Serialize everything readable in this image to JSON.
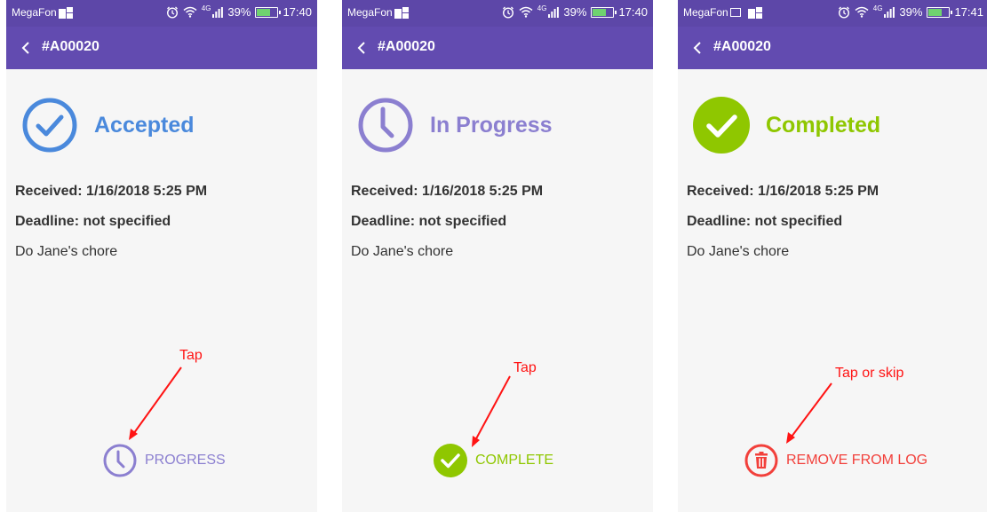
{
  "status_bar": {
    "screens": [
      {
        "carrier": "MegaFon",
        "network": "4G",
        "battery": "39%",
        "battery_level": 0.39,
        "time": "17:40"
      },
      {
        "carrier": "MegaFon",
        "network": "4G",
        "battery": "39%",
        "battery_level": 0.39,
        "time": "17:40"
      },
      {
        "carrier": "MegaFon",
        "network": "4G",
        "battery": "39%",
        "battery_level": 0.39,
        "time": "17:41"
      }
    ]
  },
  "app_bar": {
    "title": "#A00020"
  },
  "details": {
    "received": "Received: 1/16/2018 5:25 PM",
    "deadline": "Deadline: not specified",
    "description": "Do Jane's chore"
  },
  "screens": [
    {
      "status": "Accepted",
      "status_color": "#4a89dc",
      "status_icon": "check-circle-outline-icon",
      "action": "PROGRESS",
      "action_color": "#8b7fd0",
      "action_icon": "clock-icon",
      "annotation": "Tap"
    },
    {
      "status": "In Progress",
      "status_color": "#8b7fd0",
      "status_icon": "clock-icon",
      "action": "COMPLETE",
      "action_color": "#8fc700",
      "action_icon": "check-circle-filled-icon",
      "annotation": "Tap"
    },
    {
      "status": "Completed",
      "status_color": "#8fc700",
      "status_icon": "check-circle-filled-icon",
      "action": "REMOVE FROM LOG",
      "action_color": "#f2403b",
      "action_icon": "trash-icon",
      "annotation": "Tap or skip"
    }
  ],
  "colors": {
    "app_bar": "#624bb0",
    "status_bar": "#5d47a8",
    "annotation": "#ff1414",
    "background": "#f6f6f6"
  }
}
